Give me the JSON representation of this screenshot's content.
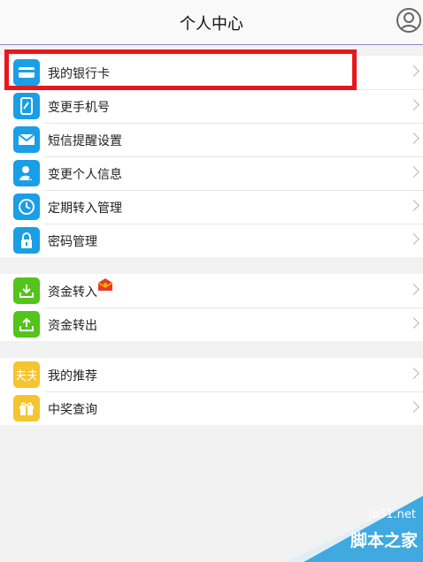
{
  "header": {
    "title": "个人中心"
  },
  "groups": [
    {
      "items": [
        {
          "label": "我的银行卡",
          "color": "#1a9ee6"
        },
        {
          "label": "变更手机号",
          "color": "#1a9ee6"
        },
        {
          "label": "短信提醒设置",
          "color": "#1a9ee6"
        },
        {
          "label": "变更个人信息",
          "color": "#1a9ee6"
        },
        {
          "label": "定期转入管理",
          "color": "#1a9ee6"
        },
        {
          "label": "密码管理",
          "color": "#1a9ee6"
        }
      ]
    },
    {
      "items": [
        {
          "label": "资金转入",
          "color": "#52c41a"
        },
        {
          "label": "资金转出",
          "color": "#52c41a"
        }
      ]
    },
    {
      "items": [
        {
          "label": "我的推荐",
          "color": "#f5c431"
        },
        {
          "label": "中奖查询",
          "color": "#f5c431"
        }
      ]
    }
  ],
  "watermark": {
    "url": "jb51.net",
    "name": "脚本之家"
  }
}
